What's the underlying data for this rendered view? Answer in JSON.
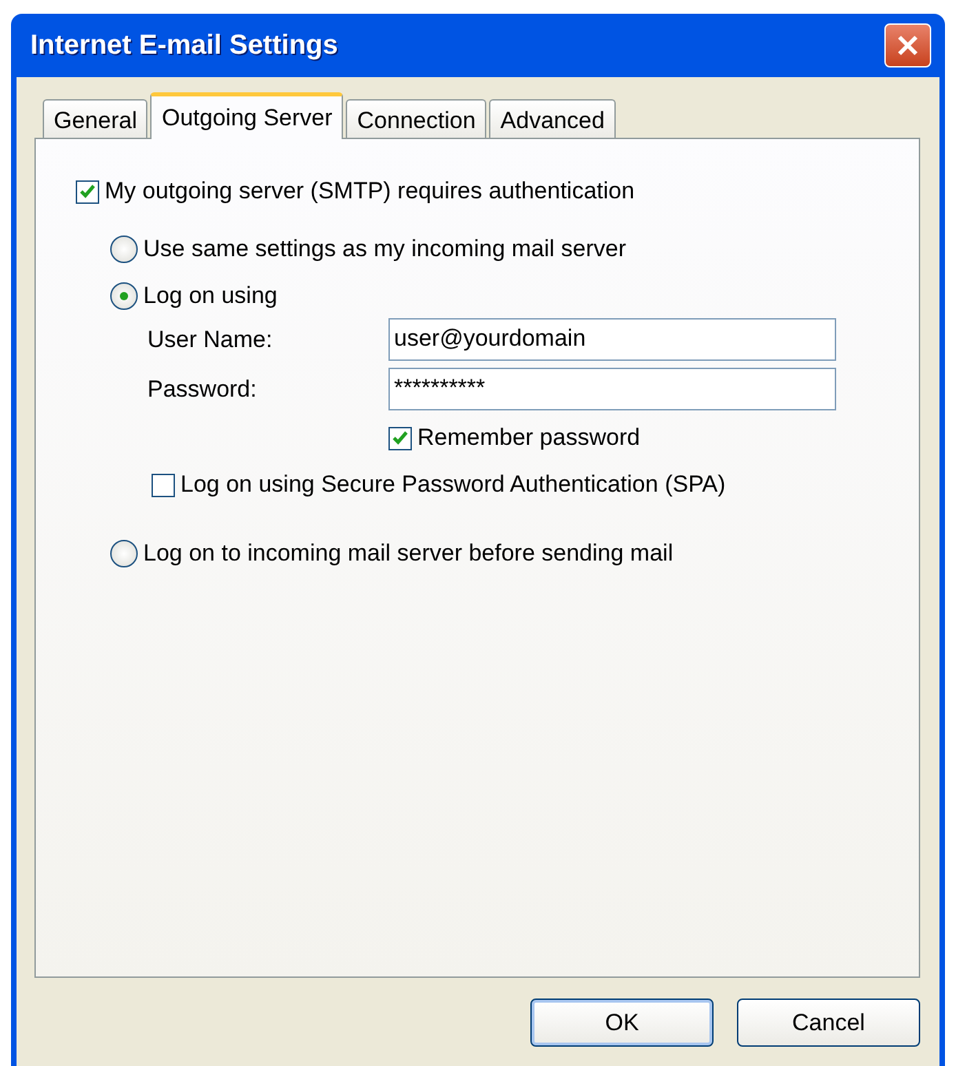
{
  "window": {
    "title": "Internet E-mail Settings"
  },
  "tabs": [
    {
      "label": "General",
      "selected": false
    },
    {
      "label": "Outgoing Server",
      "selected": true
    },
    {
      "label": "Connection",
      "selected": false
    },
    {
      "label": "Advanced",
      "selected": false
    }
  ],
  "authentication": {
    "label": "My outgoing server (SMTP) requires authentication",
    "checked": true
  },
  "logon_options": [
    {
      "label": "Use same settings as my incoming mail server",
      "selected": false
    },
    {
      "label": "Log on using",
      "selected": true,
      "fields": [
        {
          "label": "User Name:",
          "value": "user@yourdomain"
        },
        {
          "label": "Password:",
          "value": "**********"
        }
      ],
      "remember_password": {
        "label": "Remember password",
        "checked": true
      },
      "spa": {
        "label": "Log on using Secure Password Authentication (SPA)",
        "checked": false
      }
    },
    {
      "label": "Log on to incoming mail server before sending mail",
      "selected": false
    }
  ],
  "buttons": [
    "OK",
    "Cancel"
  ]
}
